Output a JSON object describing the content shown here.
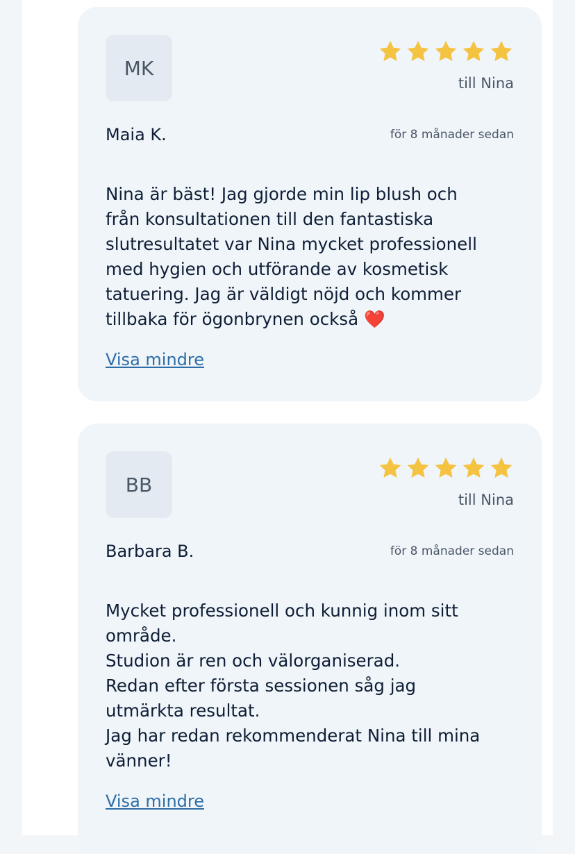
{
  "reviews": [
    {
      "initials": "MK",
      "rating": 5,
      "recipient": "till Nina",
      "author": "Maia K.",
      "time": "för 8 månader sedan",
      "text": "Nina är bäst! Jag gjorde min lip blush och\nfrån konsultationen till den fantastiska\nslutresultatet var Nina mycket professionell\nmed hygien och utförande av kosmetisk\ntatuering. Jag är väldigt nöjd och kommer\ntillbaka för ögonbrynen också ❤️",
      "toggle_label": "Visa mindre"
    },
    {
      "initials": "BB",
      "rating": 5,
      "recipient": "till Nina",
      "author": "Barbara B.",
      "time": "för 8 månader sedan",
      "text": "Mycket professionell och kunnig inom sitt\nområde.\nStudion är ren och välorganiserad.\nRedan efter första sessionen såg jag\nutmärkta resultat.\nJag har redan rekommenderat Nina till mina\nvänner!",
      "toggle_label": "Visa mindre"
    }
  ],
  "colors": {
    "star": "#f5c342",
    "link": "#2f6da6",
    "card_bg": "#eff5f9"
  }
}
